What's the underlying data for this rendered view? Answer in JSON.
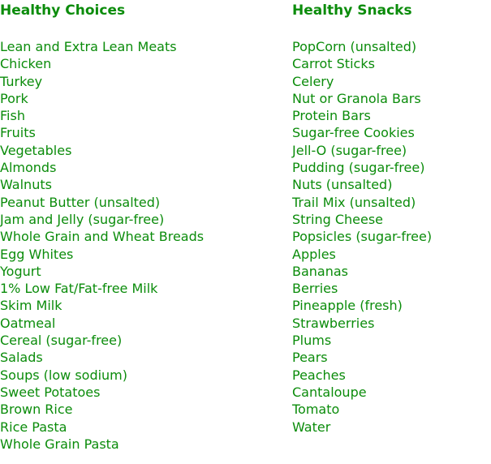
{
  "theme": {
    "text_color": "#0b8c0b",
    "background_color": "#ffffff"
  },
  "columns": {
    "healthy_choices": {
      "heading": "Healthy Choices",
      "items": [
        "Lean and Extra Lean Meats",
        "Chicken",
        "Turkey",
        "Pork",
        "Fish",
        "Fruits",
        "Vegetables",
        "Almonds",
        "Walnuts",
        "Peanut Butter (unsalted)",
        "Jam and Jelly (sugar-free)",
        "Whole Grain and Wheat Breads",
        "Egg Whites",
        "Yogurt",
        "1% Low Fat/Fat-free Milk",
        "Skim Milk",
        "Oatmeal",
        "Cereal (sugar-free)",
        "Salads",
        "Soups (low sodium)",
        "Sweet Potatoes",
        "Brown Rice",
        "Rice Pasta",
        "Whole Grain Pasta"
      ]
    },
    "healthy_snacks": {
      "heading": "Healthy Snacks",
      "items": [
        "PopCorn (unsalted)",
        "Carrot Sticks",
        "Celery",
        "Nut or Granola Bars",
        "Protein Bars",
        "Sugar-free Cookies",
        "Jell-O (sugar-free)",
        "Pudding (sugar-free)",
        "Nuts (unsalted)",
        "Trail Mix (unsalted)",
        "String Cheese",
        "Popsicles (sugar-free)",
        "Apples",
        "Bananas",
        "Berries",
        "Pineapple (fresh)",
        "Strawberries",
        "Plums",
        "Pears",
        "Peaches",
        "Cantaloupe",
        "Tomato",
        "Water"
      ]
    }
  }
}
